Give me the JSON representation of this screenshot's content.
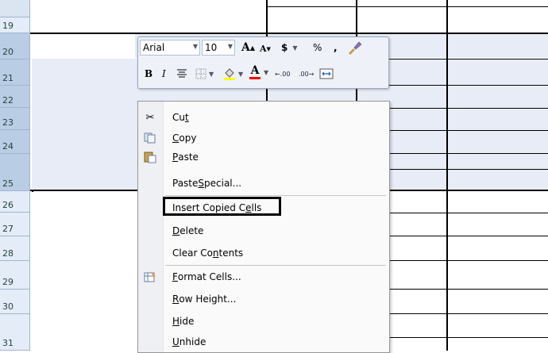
{
  "rows": [
    "19",
    "20",
    "21",
    "22",
    "23",
    "24",
    "25",
    "26",
    "27",
    "28",
    "29",
    "30",
    "31"
  ],
  "mini_toolbar": {
    "font_name": "Arial",
    "font_size": "10",
    "grow_font": "A",
    "shrink_font": "A",
    "currency": "$",
    "percent": "%",
    "comma": ",",
    "bold": "B",
    "italic": "I",
    "font_color_letter": "A",
    "inc_decimal": ".00",
    "dec_decimal": ".00"
  },
  "context_menu": {
    "items": [
      {
        "id": "cut",
        "pre": "Cu",
        "u": "t",
        "post": ""
      },
      {
        "id": "copy",
        "pre": "",
        "u": "C",
        "post": "opy"
      },
      {
        "id": "paste",
        "pre": "",
        "u": "P",
        "post": "aste"
      },
      {
        "id": "paste-special",
        "pre": "Paste ",
        "u": "S",
        "post": "pecial..."
      },
      {
        "id": "insert-copied-cells",
        "pre": "Insert Copied C",
        "u": "e",
        "post": "lls"
      },
      {
        "id": "delete",
        "pre": "",
        "u": "D",
        "post": "elete"
      },
      {
        "id": "clear-contents",
        "pre": "Clear Co",
        "u": "n",
        "post": "tents"
      },
      {
        "id": "format-cells",
        "pre": "",
        "u": "F",
        "post": "ormat Cells..."
      },
      {
        "id": "row-height",
        "pre": "",
        "u": "R",
        "post": "ow Height..."
      },
      {
        "id": "hide",
        "pre": "",
        "u": "H",
        "post": "ide"
      },
      {
        "id": "unhide",
        "pre": "",
        "u": "U",
        "post": "nhide"
      }
    ]
  }
}
